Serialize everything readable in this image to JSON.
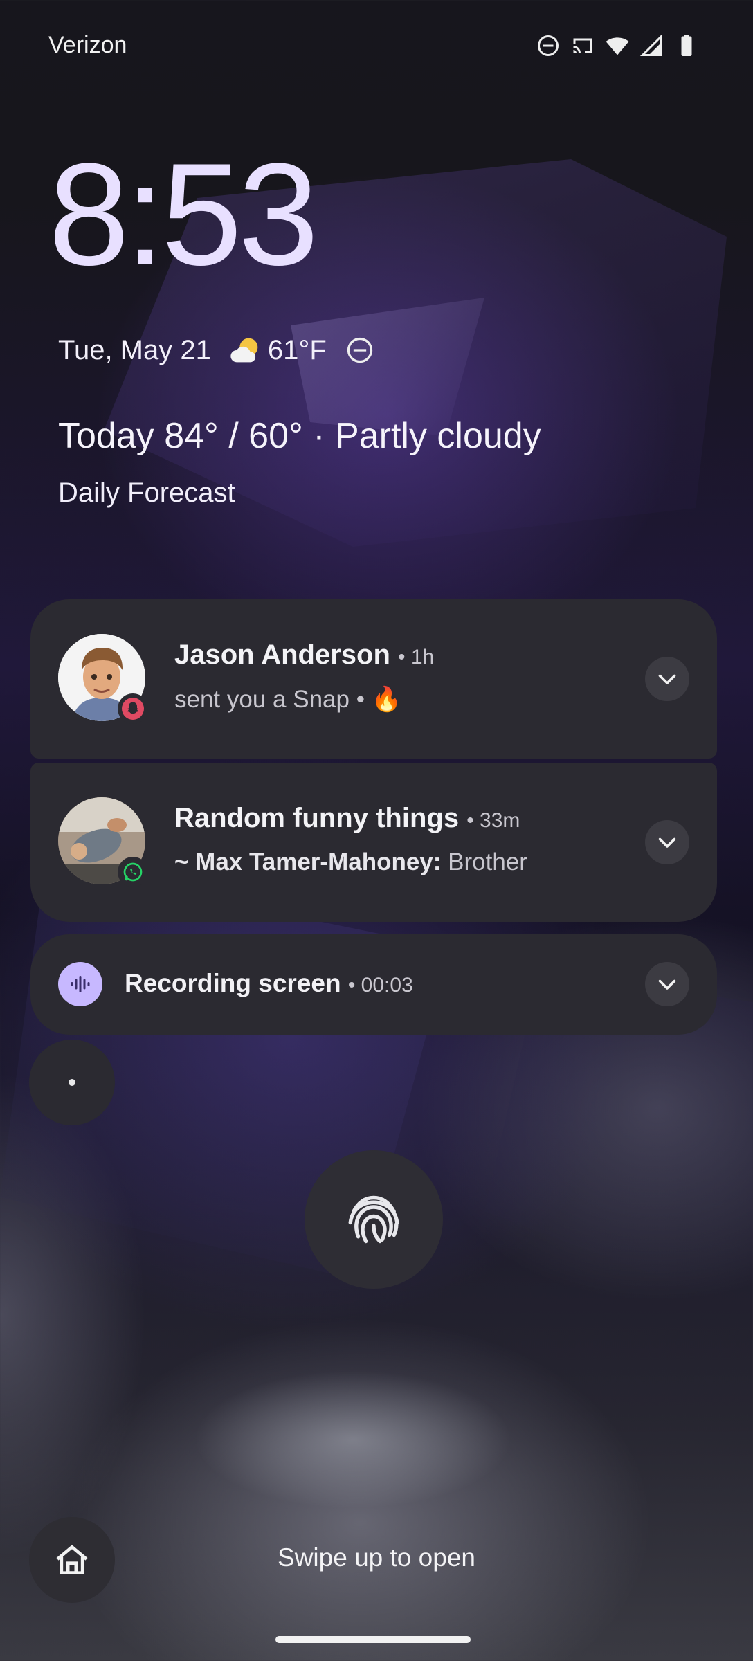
{
  "status_bar": {
    "carrier": "Verizon",
    "icons": [
      "do-not-disturb-icon",
      "cast-icon",
      "wifi-icon",
      "cell-signal-icon",
      "battery-icon"
    ]
  },
  "lockscreen": {
    "time": "8:53",
    "date": "Tue, May 21",
    "weather_icon": "partly-cloudy-icon",
    "temperature": "61°F",
    "forecast": "Today 84° / 60° · Partly cloudy",
    "forecast_link": "Daily Forecast"
  },
  "notifications": [
    {
      "title": "Jason Anderson",
      "time": "• 1h",
      "text": "sent you a Snap • 🔥",
      "app_icon": "snapchat-icon",
      "expand_icon": "chevron-down-icon"
    },
    {
      "title": "Random funny things",
      "time": "• 33m",
      "sender": "~ Max Tamer-Mahoney:",
      "text": "Brother",
      "app_icon": "whatsapp-icon",
      "expand_icon": "chevron-down-icon"
    },
    {
      "title": "Recording screen",
      "time": "• 00:03",
      "app_icon": "screen-record-icon",
      "expand_icon": "chevron-down-icon"
    }
  ],
  "footer": {
    "swipe_hint": "Swipe up to open"
  },
  "colors": {
    "notification_bg": "#2b2a31",
    "clock": "#e8e0ff",
    "record_accent": "#c7b8ff"
  }
}
